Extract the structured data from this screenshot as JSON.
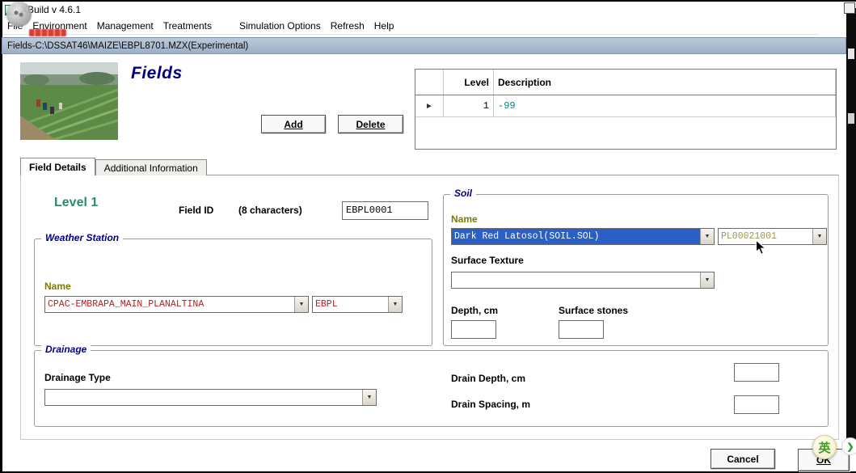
{
  "titlebar": {
    "title": "XBuild v 4.6.1"
  },
  "menu": {
    "items": [
      "File",
      "Environment",
      "Management",
      "Treatments",
      "Simulation Options",
      "Refresh",
      "Help"
    ]
  },
  "document_window": {
    "caption": "Fields-C:\\DSSAT46\\MAIZE\\EBPL8701.MZX(Experimental)"
  },
  "header": {
    "title": "Fields",
    "add_label": "Add",
    "delete_label": "Delete"
  },
  "grid": {
    "level_header": "Level",
    "description_header": "Description",
    "row": {
      "level": "1",
      "description": "-99"
    }
  },
  "tabs": {
    "field_details": "Field Details",
    "additional_information": "Additional Information"
  },
  "form": {
    "level_title": "Level 1",
    "field_id_label": "Field ID",
    "field_id_hint": "(8 characters)",
    "field_id_value": "EBPL0001",
    "weather_station": {
      "title": "Weather Station",
      "name_label": "Name",
      "station_name": "CPAC-EMBRAPA_MAIN_PLANALTINA",
      "station_code": "EBPL"
    },
    "soil": {
      "title": "Soil",
      "name_label": "Name",
      "soil_name": "Dark Red Latosol(SOIL.SOL)",
      "profile_id": "PL00021001",
      "surface_texture_label": "Surface Texture",
      "surface_texture_value": "",
      "depth_label": "Depth, cm",
      "depth_value": "",
      "surface_stones_label": "Surface stones",
      "surface_stones_value": ""
    },
    "drainage": {
      "title": "Drainage",
      "type_label": "Drainage Type",
      "type_value": "",
      "drain_depth_label": "Drain Depth, cm",
      "drain_depth_value": "",
      "drain_spacing_label": "Drain Spacing, m",
      "drain_spacing_value": ""
    }
  },
  "footer": {
    "cancel_label": "Cancel",
    "ok_label": "OK"
  },
  "ime": {
    "lang_indicator": "英"
  },
  "icons": {
    "dropdown": "▼",
    "row_marker": "►",
    "chevron_right": "❯"
  },
  "colors": {
    "group_title": "#000080",
    "heading": "#000080",
    "olive_label": "#7b7b00",
    "station_value": "#b22222",
    "description_value": "#008080",
    "profile_value": "#9a9a4a",
    "selection_bg": "#2a5fc5",
    "level_title": "#2e8b6b"
  }
}
